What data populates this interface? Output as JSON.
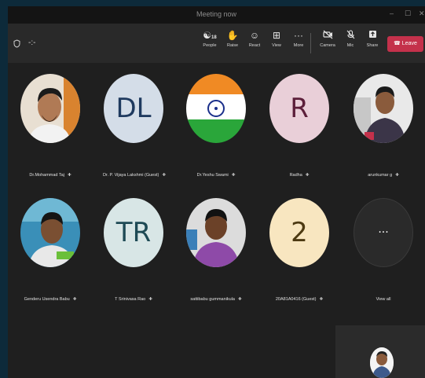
{
  "window": {
    "title": "Meeting now",
    "minimize_glyph": "–",
    "maximize_glyph": "☐",
    "close_glyph": "✕"
  },
  "toolbar": {
    "timer": "-:-",
    "people_count": "18",
    "people_label": "People",
    "raise_label": "Raise",
    "react_label": "React",
    "view_label": "View",
    "more_label": "More",
    "camera_label": "Camera",
    "mic_label": "Mic",
    "share_label": "Share",
    "leave_label": "Leave",
    "accent_color": "#c4314b"
  },
  "participants": [
    {
      "name": "Dr.Mohammad Taj",
      "avatar": "photo"
    },
    {
      "name": "Dr. P. Vijaya Lakshmi (Guest)",
      "initials": "DL",
      "bg": "#d4dde8",
      "fg": "#1f3a5f"
    },
    {
      "name": "Dr.Yeshu Swami",
      "avatar": "flag-icon"
    },
    {
      "name": "Radha",
      "initials": "R",
      "bg": "#e9cfd8",
      "fg": "#5c1f3a"
    },
    {
      "name": "arunkumar g",
      "avatar": "photo"
    },
    {
      "name": "Genderu Usendra Babu",
      "avatar": "photo"
    },
    {
      "name": "T Srinivasa Rao",
      "initials": "TR",
      "bg": "#d8e6e6",
      "fg": "#1e4a55"
    },
    {
      "name": "sattibabu gummanikula",
      "avatar": "photo"
    },
    {
      "name": "20A81A0416 (Guest)",
      "initials": "2",
      "bg": "#f8e6c0",
      "fg": "#4d3a12"
    },
    {
      "name": "View all",
      "initials": "···"
    }
  ]
}
